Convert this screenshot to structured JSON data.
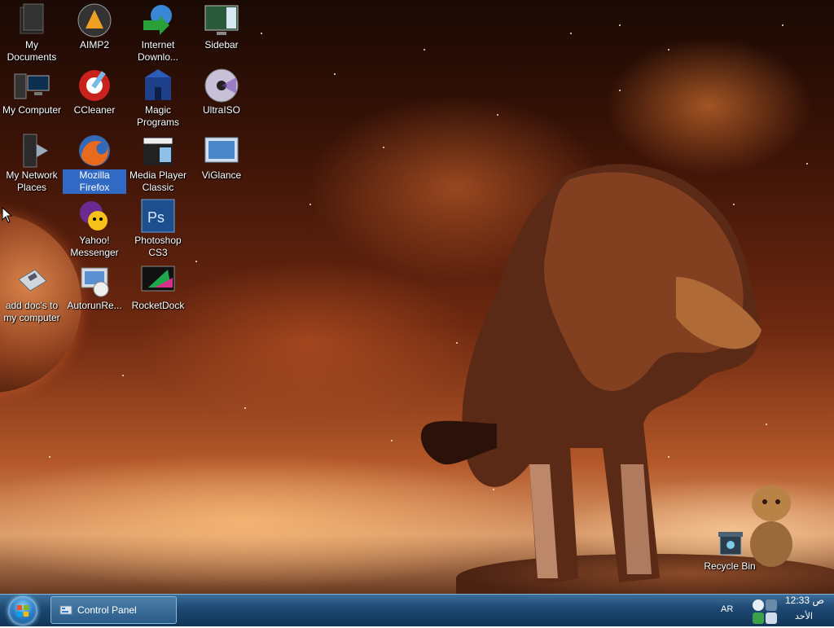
{
  "desktop": {
    "icons": [
      {
        "label": "My\nDocuments",
        "icon": "folder-dark-icon"
      },
      {
        "label": "My Computer",
        "icon": "computer-icon"
      },
      {
        "label": "My Network\nPlaces",
        "icon": "network-icon"
      },
      {
        "label": "add doc's to\nmy computer",
        "icon": "floppy-icon"
      },
      {
        "label": "AIMP2",
        "icon": "aimp-icon"
      },
      {
        "label": "CCleaner",
        "icon": "ccleaner-icon"
      },
      {
        "label": "Mozilla Firefox",
        "icon": "firefox-icon",
        "selected": true
      },
      {
        "label": "Yahoo!\nMessenger",
        "icon": "yahoo-messenger-icon"
      },
      {
        "label": "AutorunRe...",
        "icon": "autorun-icon"
      },
      {
        "label": "Internet\nDownlo...",
        "icon": "download-globe-icon"
      },
      {
        "label": "Magic\nPrograms",
        "icon": "magic-programs-icon"
      },
      {
        "label": "Media Player\nClassic",
        "icon": "media-player-icon"
      },
      {
        "label": "Photoshop\nCS3",
        "icon": "photoshop-icon"
      },
      {
        "label": "RocketDock",
        "icon": "rocketdock-icon"
      },
      {
        "label": "Sidebar",
        "icon": "sidebar-icon"
      },
      {
        "label": "UltraISO",
        "icon": "ultraiso-icon"
      },
      {
        "label": "ViGlance",
        "icon": "viglance-icon"
      },
      {
        "label": "Recycle Bin",
        "icon": "recycle-bin-icon"
      }
    ]
  },
  "taskbar": {
    "start_icon": "windows-start-orb-icon",
    "tasks": [
      {
        "label": "Control Panel",
        "icon": "control-panel-icon"
      }
    ],
    "language": "AR",
    "clock_time": "12:33 ص",
    "clock_day": "الأحد"
  },
  "colors": {
    "taskbar": "#1e4a74",
    "selection": "#316ac5"
  }
}
